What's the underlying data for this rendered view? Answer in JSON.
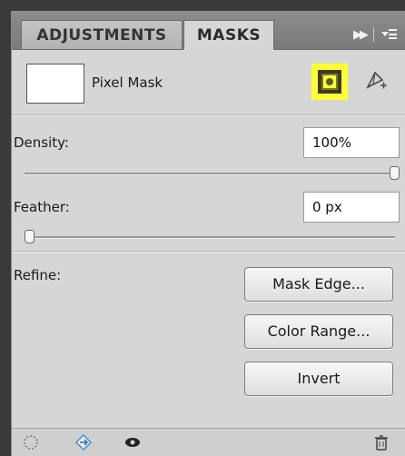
{
  "tabs": [
    {
      "label": "ADJUSTMENTS",
      "active": false
    },
    {
      "label": "MASKS",
      "active": true
    }
  ],
  "header_icons": {
    "collapse": "double-arrow-icon",
    "menu": "panel-menu-icon"
  },
  "mask": {
    "label": "Pixel Mask",
    "pixel_mask_icon": "pixel-mask-icon",
    "vector_mask_icon": "vector-mask-add-icon",
    "highlight_color": "#ffff33"
  },
  "density": {
    "label": "Density:",
    "value": "100%",
    "slider_fraction": 1.0
  },
  "feather": {
    "label": "Feather:",
    "value": "0 px",
    "slider_fraction": 0.0
  },
  "refine": {
    "label": "Refine:",
    "buttons": [
      "Mask Edge...",
      "Color Range...",
      "Invert"
    ]
  },
  "footer_icons": [
    "load-selection-icon",
    "apply-mask-icon",
    "visibility-eye-icon",
    "trash-icon"
  ]
}
